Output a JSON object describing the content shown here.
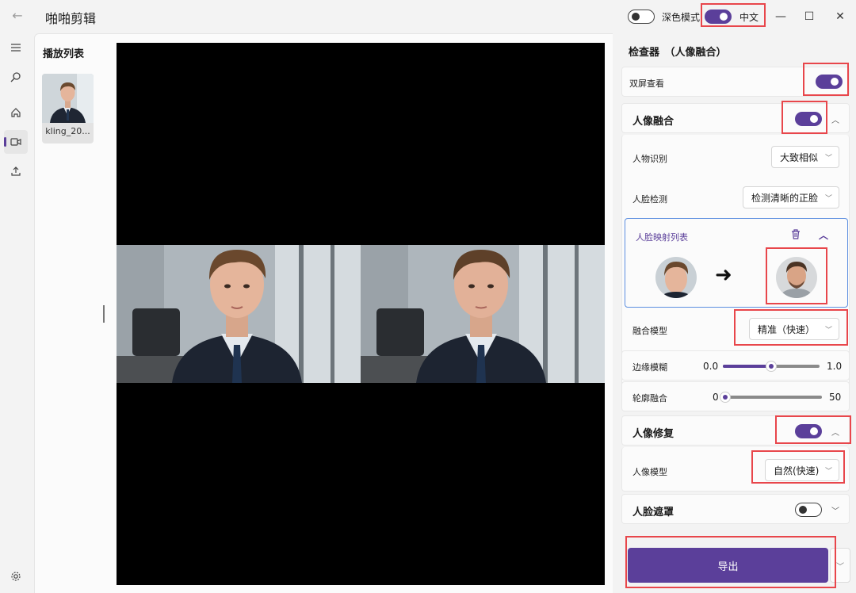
{
  "window": {
    "app_title": "啪啪剪辑",
    "back_icon": "←",
    "minimize_icon": "—",
    "maximize_icon": "☐",
    "close_icon": "✕",
    "dark_mode_label": "深色模式",
    "language_label": "中文"
  },
  "nav": {
    "menu_icon": "menu-icon",
    "search_icon": "search-icon",
    "home_icon": "home-icon",
    "video_icon": "video-icon",
    "upload_icon": "upload-icon",
    "settings_icon": "gear-icon"
  },
  "playlist": {
    "title": "播放列表",
    "items": [
      {
        "name": "kling_20..."
      }
    ]
  },
  "inspector": {
    "title": "检查器　（人像融合）",
    "dual_screen_label": "双屏查看",
    "face_fusion": {
      "label": "人像融合",
      "person_recognition_label": "人物识别",
      "person_recognition_value": "大致相似",
      "face_detection_label": "人脸检测",
      "face_detection_value": "检测清晰的正脸",
      "mapping_list_label": "人脸映射列表",
      "arrow": "➜",
      "fusion_model_label": "融合模型",
      "fusion_model_value": "精准（快速）",
      "edge_blur_label": "边缘模糊",
      "edge_blur_min": "0.0",
      "edge_blur_max": "1.0",
      "edge_blur_fraction": 0.5,
      "contour_fusion_label": "轮廓融合",
      "contour_fusion_min": "0",
      "contour_fusion_max": "50",
      "contour_fusion_fraction": 0.0
    },
    "face_restore": {
      "label": "人像修复",
      "model_label": "人像模型",
      "model_value": "自然(快速)"
    },
    "face_mask": {
      "label": "人脸遮罩"
    },
    "export_label": "导出"
  },
  "colors": {
    "accent": "#5b3f9a",
    "annotation": "#e8464b"
  }
}
